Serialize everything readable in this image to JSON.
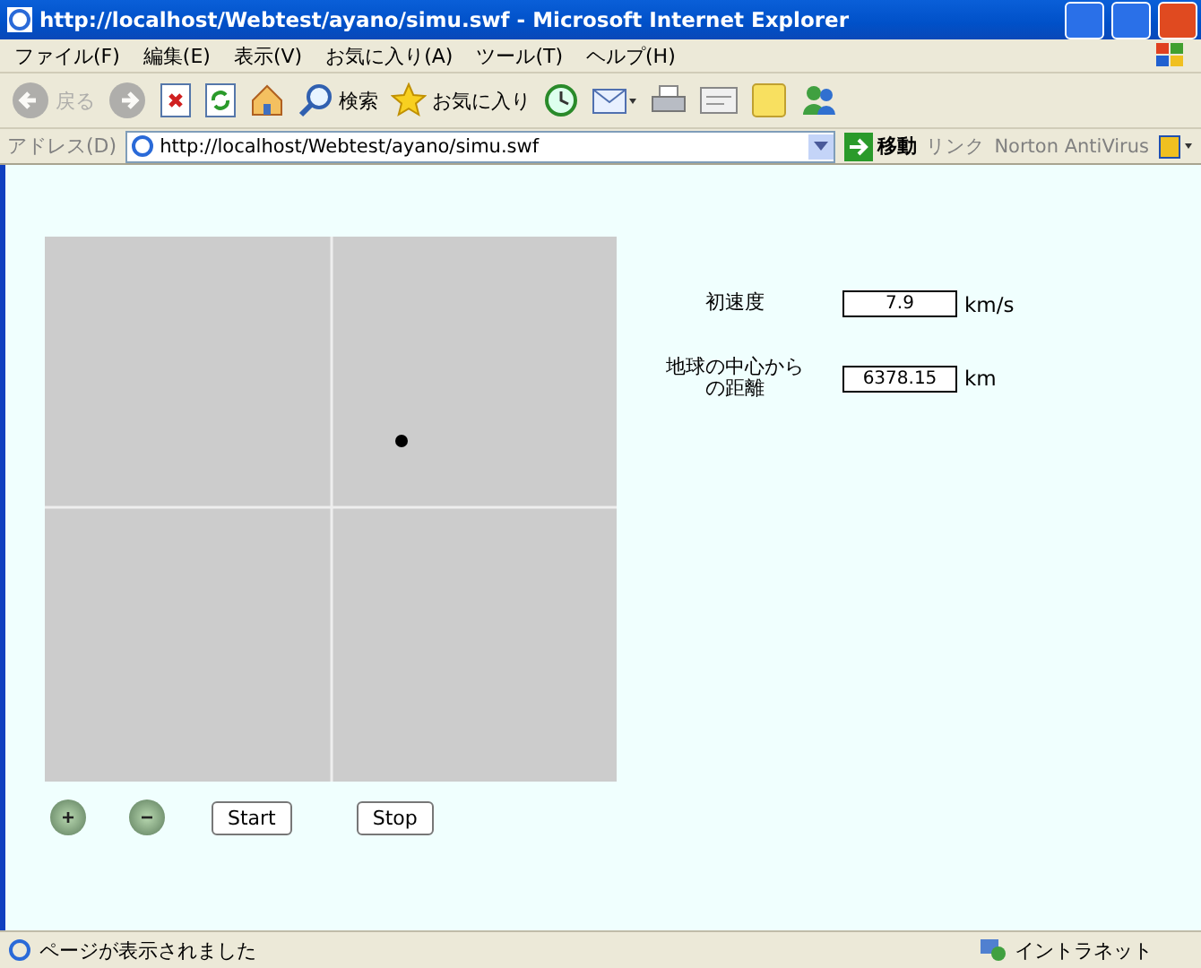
{
  "window": {
    "title": "http://localhost/Webtest/ayano/simu.swf - Microsoft Internet Explorer"
  },
  "menu": [
    "ファイル(F)",
    "編集(E)",
    "表示(V)",
    "お気に入り(A)",
    "ツール(T)",
    "ヘルプ(H)"
  ],
  "toolbar": [
    {
      "kind": "back",
      "label": "戻る",
      "disabled": true
    },
    {
      "kind": "forward",
      "disabled": true
    },
    {
      "kind": "stop",
      "disabled": false
    },
    {
      "kind": "refresh",
      "disabled": false
    },
    {
      "kind": "home",
      "disabled": false
    },
    {
      "kind": "search",
      "label": "検索",
      "disabled": false
    },
    {
      "kind": "favorites",
      "label": "お気に入り",
      "disabled": false
    },
    {
      "kind": "history",
      "disabled": false
    },
    {
      "kind": "mail",
      "disabled": false
    },
    {
      "kind": "print",
      "disabled": false
    },
    {
      "kind": "edit",
      "disabled": false
    },
    {
      "kind": "note",
      "disabled": false
    },
    {
      "kind": "messenger",
      "disabled": false
    }
  ],
  "address_bar": {
    "label": "アドレス(D)",
    "url": "http://localhost/Webtest/ayano/simu.swf",
    "go": "移動",
    "links": "リンク",
    "norton": "Norton AntiVirus"
  },
  "simulation": {
    "zoom_in": "+",
    "zoom_out": "−",
    "start": "Start",
    "stop": "Stop"
  },
  "params": [
    {
      "label": "初速度",
      "value": "7.9",
      "unit": "km/s"
    },
    {
      "label": "地球の中心からの距離",
      "value": "6378.15",
      "unit": "km"
    }
  ],
  "status_bar": {
    "message": "ページが表示されました",
    "zone": "イントラネット"
  }
}
